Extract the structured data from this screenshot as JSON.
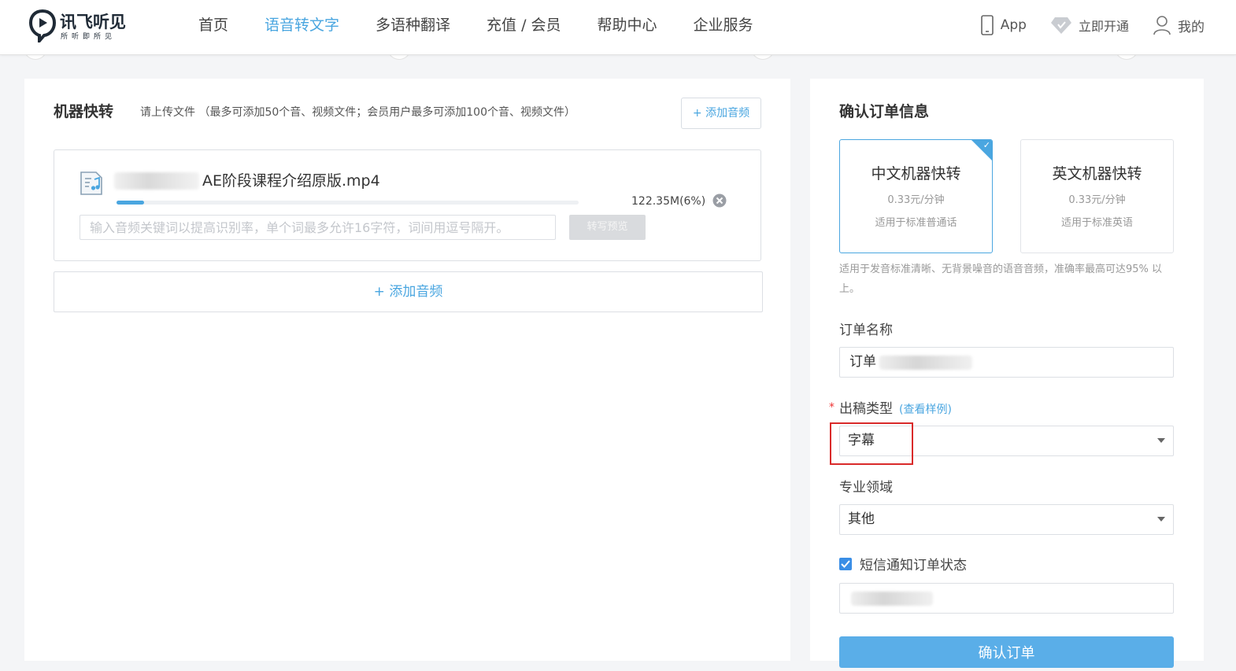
{
  "header": {
    "logo_text": "讯飞听见",
    "logo_sub": "所听即所见",
    "nav": [
      {
        "label": "首页"
      },
      {
        "label": "语音转文字"
      },
      {
        "label": "多语种翻译"
      },
      {
        "label": "充值 / 会员"
      },
      {
        "label": "帮助中心"
      },
      {
        "label": "企业服务"
      }
    ],
    "app_label": "App",
    "vip_label": "立即开通",
    "account_label": "我的",
    "accent_color": "#4aa6e0"
  },
  "upload": {
    "title": "机器快转",
    "hint": "请上传文件 （最多可添加50个音、视频文件；会员用户最多可添加100个音、视频文件）",
    "add_button_top": "+ 添加音频",
    "file": {
      "name": "AE阶段课程介绍原版.mp4",
      "size": "122.35M(6%)",
      "progress_percent": 6,
      "keyword_placeholder": "输入音频关键词以提高识别率，单个词最多允许16字符，词间用逗号隔开。",
      "preview_button": "转写预览"
    },
    "add_button_bottom": "+ 添加音频"
  },
  "order": {
    "title": "确认订单信息",
    "services": [
      {
        "name": "中文机器快转",
        "price": "0.33元/分钟",
        "desc": "适用于标准普通话",
        "selected": true
      },
      {
        "name": "英文机器快转",
        "price": "0.33元/分钟",
        "desc": "适用于标准英语",
        "selected": false
      }
    ],
    "service_note": "适用于发音标准清晰、无背景噪音的语音音频，准确率最高可达95% 以上。",
    "order_name_label": "订单名称",
    "order_name_value": "订单",
    "output_type_label": "出稿类型",
    "output_type_sample": "(查看样例)",
    "output_type_value": "字幕",
    "domain_label": "专业领域",
    "domain_value": "其他",
    "sms_label": "短信通知订单状态",
    "sms_checked": true,
    "submit_label": "确认订单"
  }
}
